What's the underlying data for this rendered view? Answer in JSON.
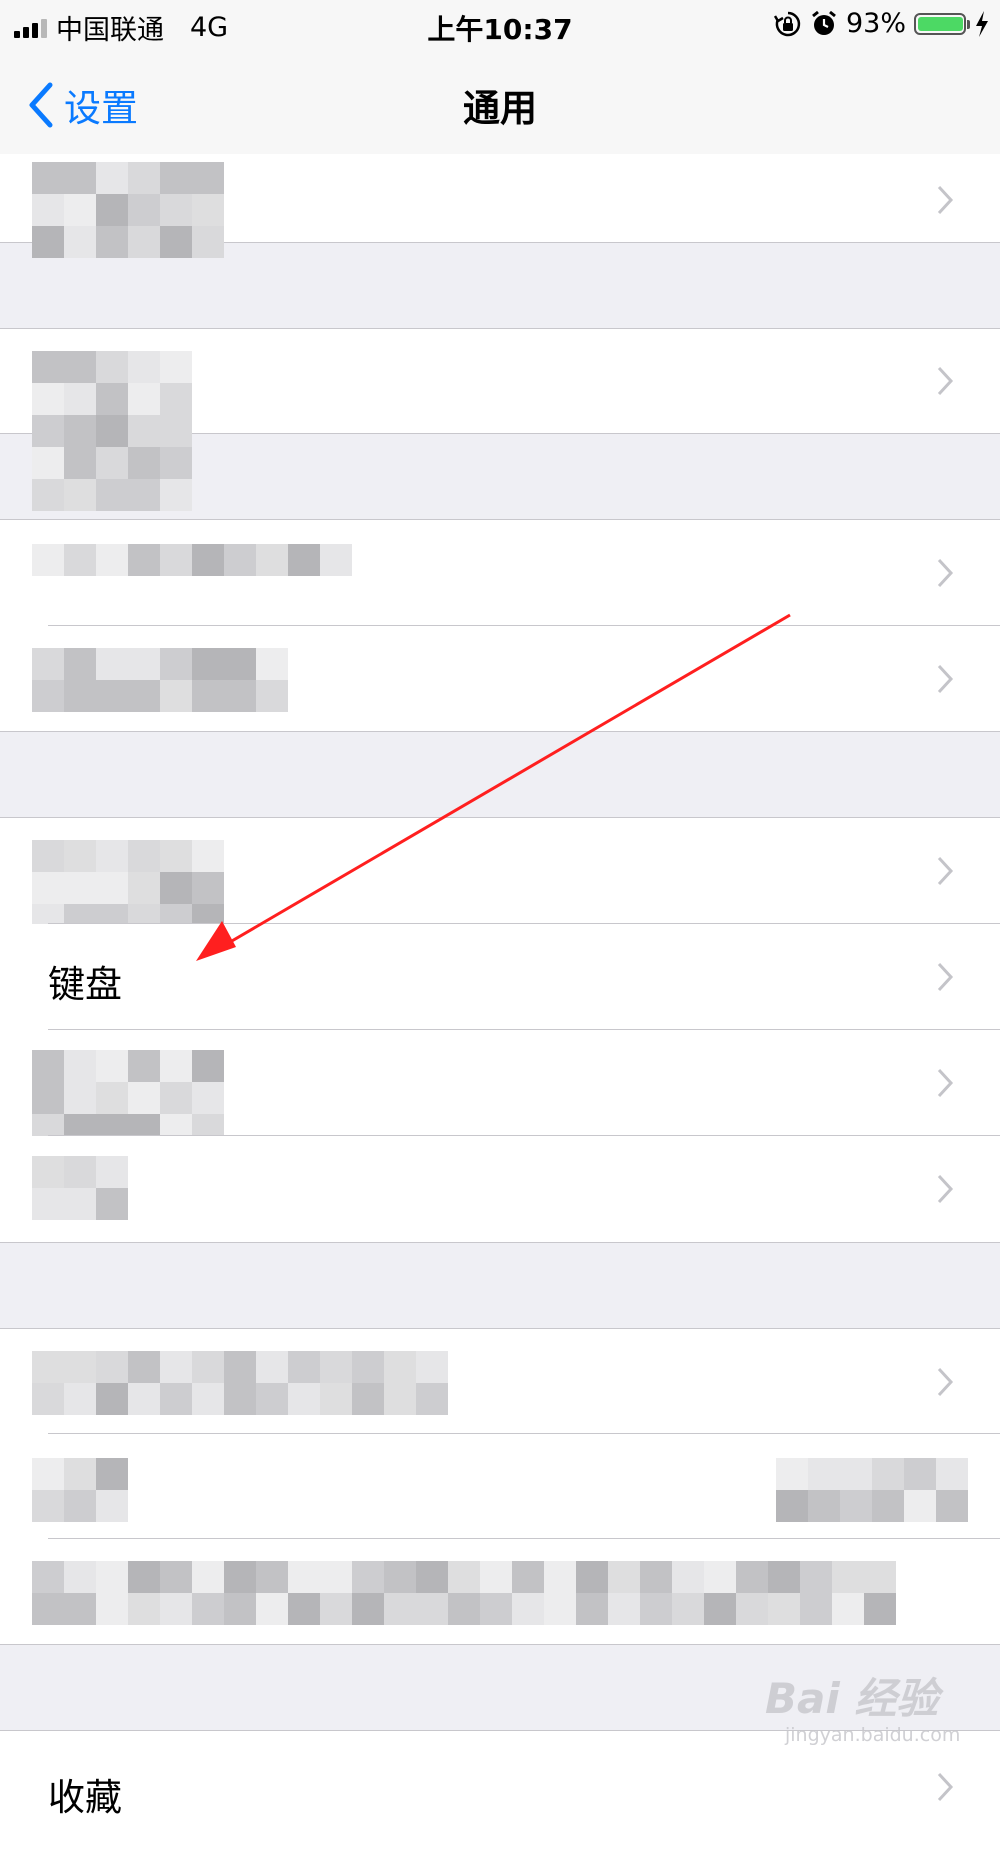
{
  "status_bar": {
    "signal_bars": 4,
    "signal_bars_active": 3,
    "carrier": "中国联通",
    "network": "4G",
    "time": "上午10:37",
    "battery_percent": "93%",
    "battery_level": 0.93,
    "icons": [
      "rotation-lock-icon",
      "alarm-icon",
      "battery-icon",
      "charging-bolt-icon"
    ]
  },
  "nav": {
    "back_label": "设置",
    "title": "通用"
  },
  "rows": [
    {
      "label": ""
    },
    {
      "label": ""
    },
    {
      "label": ""
    },
    {
      "label": ""
    },
    {
      "label": ""
    },
    {
      "label": "键盘"
    },
    {
      "label": ""
    },
    {
      "label": ""
    },
    {
      "label": ""
    },
    {
      "label": ""
    },
    {
      "label": ""
    },
    {
      "label": "收藏"
    }
  ],
  "colors": {
    "accent": "#0a7aff",
    "annotation_arrow": "#ff1f1f",
    "battery_fill": "#4cd964",
    "grouped_background": "#efeff4",
    "separator": "#c8c7cc",
    "chevron": "#c4c4c9"
  },
  "watermark": {
    "logo": "Bai  经验",
    "url": "jingyan.baidu.com"
  }
}
